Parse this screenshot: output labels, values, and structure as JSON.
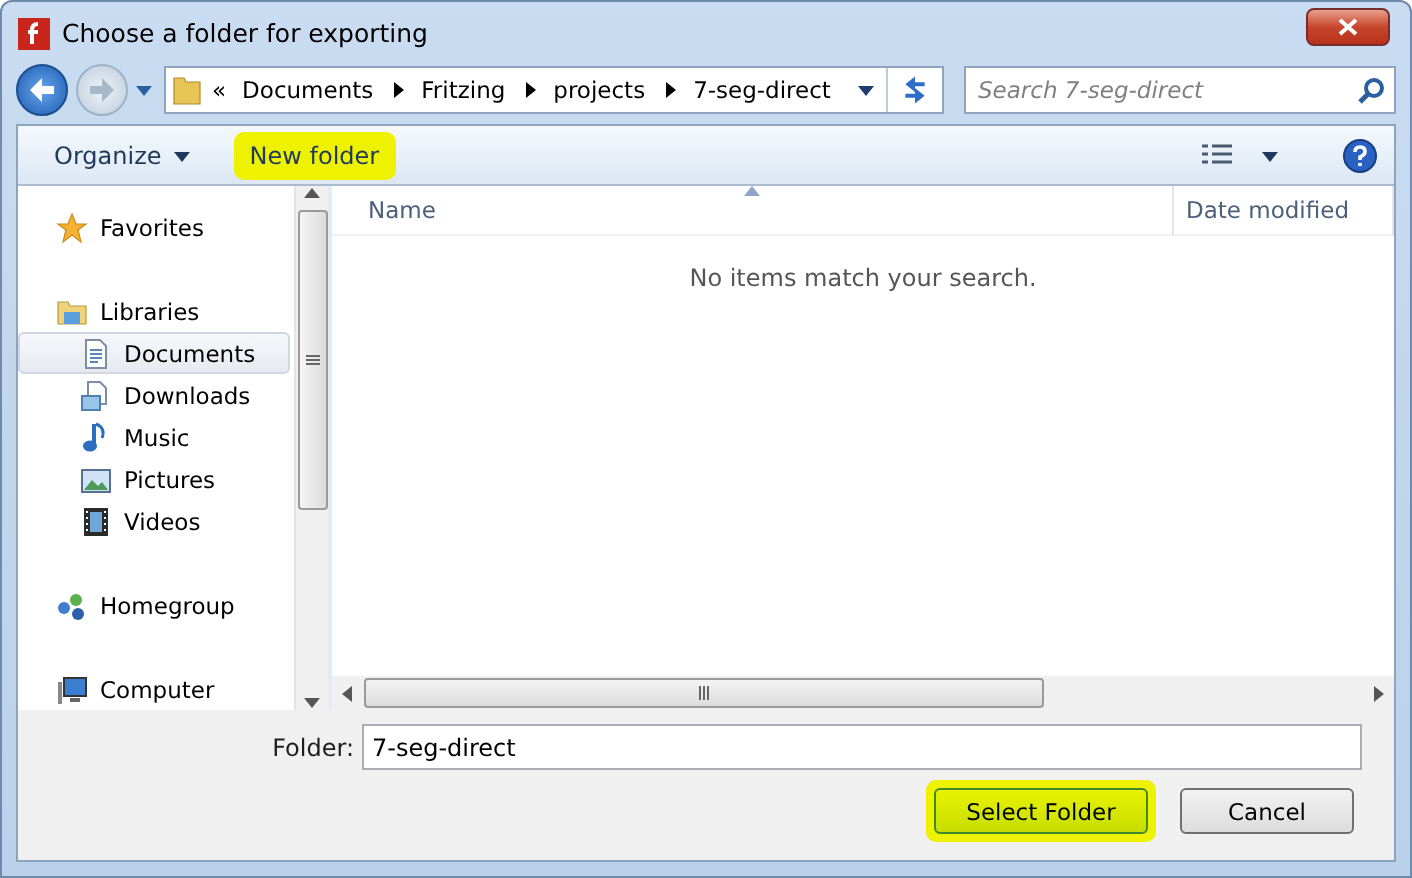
{
  "window": {
    "title": "Choose a folder for exporting"
  },
  "address": {
    "overflow": "«",
    "segments": [
      "Documents",
      "Fritzing",
      "projects",
      "7-seg-direct"
    ]
  },
  "search": {
    "placeholder": "Search 7-seg-direct"
  },
  "toolbar": {
    "organize": "Organize",
    "new_folder": {
      "label": "New folder",
      "highlighted": true
    }
  },
  "sidebar": {
    "items": [
      {
        "label": "Favorites",
        "kind": "favorites",
        "selected": false
      },
      {
        "label": "Libraries",
        "kind": "libraries",
        "selected": false,
        "children": [
          {
            "label": "Documents",
            "kind": "documents",
            "selected": true
          },
          {
            "label": "Downloads",
            "kind": "downloads",
            "selected": false
          },
          {
            "label": "Music",
            "kind": "music",
            "selected": false
          },
          {
            "label": "Pictures",
            "kind": "pictures",
            "selected": false
          },
          {
            "label": "Videos",
            "kind": "videos",
            "selected": false
          }
        ]
      },
      {
        "label": "Homegroup",
        "kind": "homegroup",
        "selected": false
      },
      {
        "label": "Computer",
        "kind": "computer",
        "selected": false
      }
    ]
  },
  "columns": [
    "Name",
    "Date modified"
  ],
  "empty_message": "No items match your search.",
  "folder": {
    "label": "Folder:",
    "value": "7-seg-direct"
  },
  "buttons": [
    {
      "label": "Select Folder",
      "kind": "primary",
      "highlighted": true
    },
    {
      "label": "Cancel",
      "kind": "secondary",
      "highlighted": false
    }
  ]
}
